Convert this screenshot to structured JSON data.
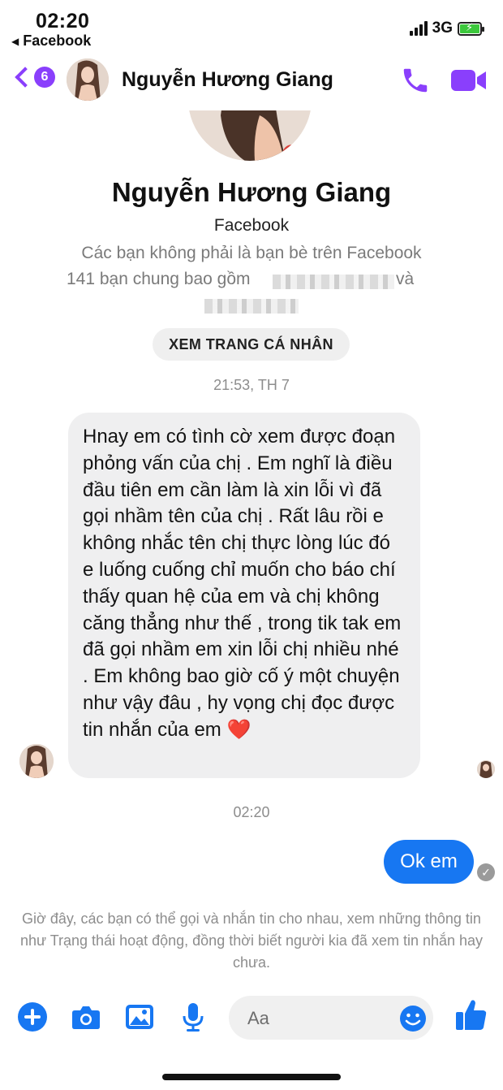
{
  "status_bar": {
    "time": "02:20",
    "back_app": "Facebook",
    "network": "3G"
  },
  "header": {
    "unread_count": "6",
    "contact_name": "Nguyễn Hương Giang",
    "call_icon": "phone-icon",
    "video_icon": "video-camera-icon"
  },
  "profile": {
    "name": "Nguyễn Hương Giang",
    "subtitle": "Facebook",
    "info_line1": "Các bạn không phải là bạn bè trên Facebook",
    "info_line2": "141 bạn chung bao gồm",
    "info_line2_end": "và",
    "view_profile_button": "XEM TRANG CÁ NHÂN"
  },
  "conversation": {
    "timestamp1": "21:53, TH 7",
    "incoming_message": "Hnay em có tình cờ xem được đoạn phỏng vấn của chị . Em nghĩ là điều đầu tiên em cần làm là xin lỗi vì đã gọi nhầm tên của chị . Rất lâu rồi e không nhắc tên chị thực lòng lúc đó e luống cuống chỉ muốn cho báo chí thấy quan hệ của em và chị không căng thẳng như thế , trong tik tak em đã gọi nhầm em xin lỗi chị nhiều nhé . Em không bao giờ cố ý một chuyện như vậy đâu , hy vọng chị đọc được tin nhắn của em ❤️",
    "timestamp2": "02:20",
    "outgoing_message": "Ok em",
    "notice": "Giờ đây, các bạn có thể gọi và nhắn tin cho nhau, xem những thông tin như Trạng thái hoạt động, đồng thời biết người kia đã xem tin nhắn hay chưa."
  },
  "composer": {
    "placeholder": "Aa",
    "icons": [
      "plus-icon",
      "camera-icon",
      "image-icon",
      "microphone-icon",
      "emoji-icon",
      "thumbs-up-icon"
    ]
  },
  "colors": {
    "accent_purple": "#8a3ffc",
    "accent_blue": "#1777f2",
    "bubble_gray": "#efeff0"
  }
}
